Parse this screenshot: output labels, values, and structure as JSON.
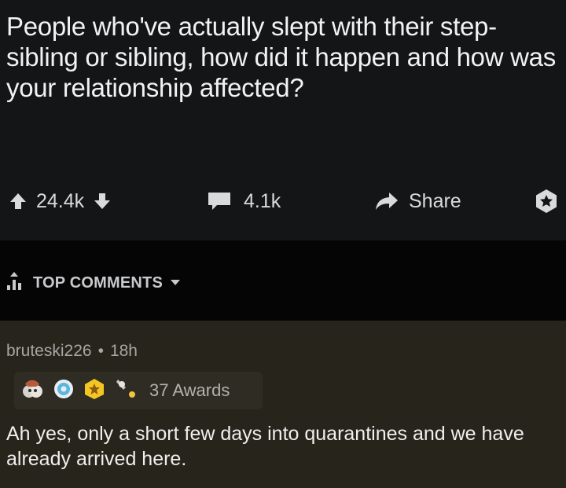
{
  "post": {
    "title": "People who've actually slept with their step-sibling or sibling, how did it happen and how was your relationship affected?",
    "upvotes": "24.4k",
    "comments": "4.1k",
    "share_label": "Share"
  },
  "sort": {
    "label": "TOP COMMENTS"
  },
  "comment": {
    "author": "bruteski226",
    "separator": "•",
    "age": "18h",
    "awards_label": "37 Awards",
    "body": "Ah yes, only a short few days into quarantines and we have already arrived here."
  },
  "colors": {
    "post_background": "#141517",
    "sortbar_background": "#050506",
    "comment_background": "#27241c",
    "text_primary": "#f2f2f2",
    "text_muted": "#a7a6a1"
  },
  "icons": [
    "upvote-arrow-icon",
    "downvote-arrow-icon",
    "comment-bubble-icon",
    "share-arrow-icon",
    "award-star-icon",
    "sort-bars-icon",
    "chevron-down-icon",
    "gold-award-icon",
    "platinum-award-icon",
    "silver-award-icon",
    "helpful-award-icon"
  ]
}
